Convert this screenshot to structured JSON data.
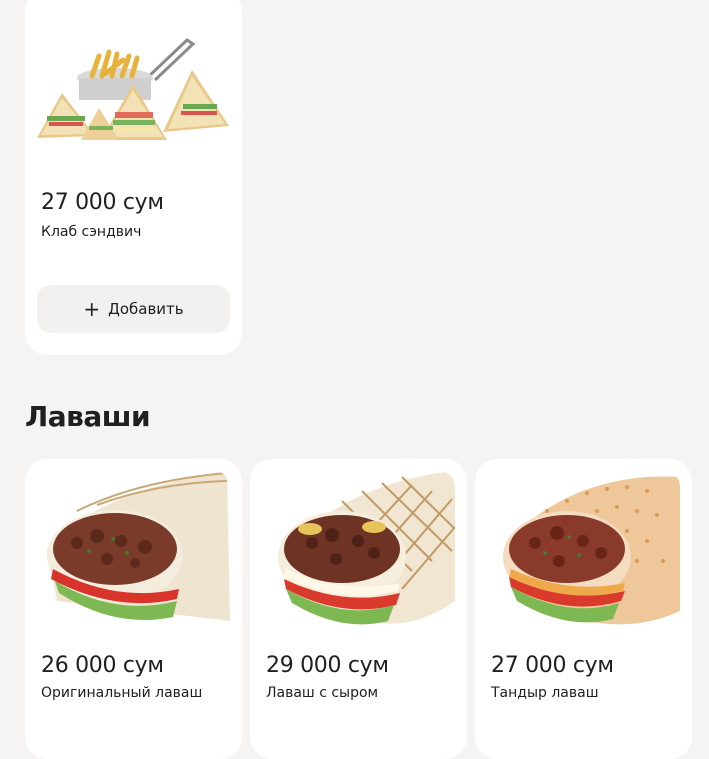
{
  "club_card": {
    "price": "27 000 сум",
    "name": "Клаб сэндвич",
    "add_label": "Добавить",
    "plus": "+"
  },
  "section": {
    "title": "Лаваши"
  },
  "lavash_cards": [
    {
      "price": "26 000 сум",
      "name": "Оригинальный лаваш"
    },
    {
      "price": "29 000 сум",
      "name": "Лаваш с сыром"
    },
    {
      "price": "27 000 сум",
      "name": "Тандыр лаваш"
    }
  ]
}
